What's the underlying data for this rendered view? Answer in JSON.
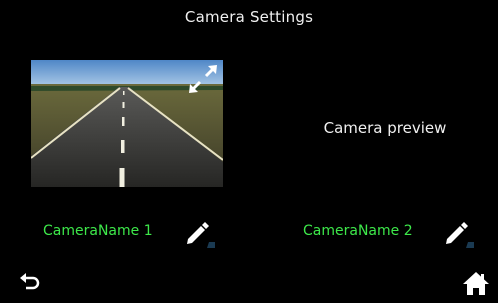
{
  "screen": {
    "title": "Camera Settings"
  },
  "camera_1": {
    "name": "CameraName 1",
    "thumbnail": "road-camera-view"
  },
  "camera_2": {
    "preview_text": "Camera preview",
    "name": "CameraName 2"
  },
  "icons": {
    "expand": "expand-arrows-icon",
    "edit": "pencil-icon",
    "back": "back-arrow-icon",
    "home": "home-icon"
  },
  "colors": {
    "background": "#000000",
    "camera_name": "#3de84a",
    "text": "#f0f0f0"
  }
}
